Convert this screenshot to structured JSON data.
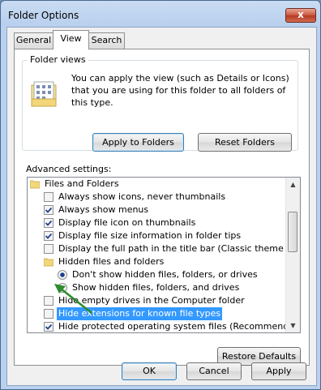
{
  "window": {
    "title": "Folder Options",
    "close_glyph": "x"
  },
  "tabs": [
    {
      "label": "General",
      "active": false
    },
    {
      "label": "View",
      "active": true
    },
    {
      "label": "Search",
      "active": false
    }
  ],
  "folder_views": {
    "label": "Folder views",
    "description": "You can apply the view (such as Details or Icons) that you are using for this folder to all folders of this type.",
    "apply_button": "Apply to Folders",
    "reset_button": "Reset Folders"
  },
  "advanced": {
    "label": "Advanced settings:",
    "items": [
      {
        "type": "folder",
        "label": "Files and Folders"
      },
      {
        "type": "checkbox",
        "checked": false,
        "label": "Always show icons, never thumbnails"
      },
      {
        "type": "checkbox",
        "checked": true,
        "label": "Always show menus"
      },
      {
        "type": "checkbox",
        "checked": true,
        "label": "Display file icon on thumbnails"
      },
      {
        "type": "checkbox",
        "checked": true,
        "label": "Display file size information in folder tips"
      },
      {
        "type": "checkbox",
        "checked": false,
        "label": "Display the full path in the title bar (Classic theme only)"
      },
      {
        "type": "folder",
        "label": "Hidden files and folders"
      },
      {
        "type": "radio",
        "checked": true,
        "label": "Don't show hidden files, folders, or drives"
      },
      {
        "type": "radio",
        "checked": false,
        "label": "Show hidden files, folders, and drives"
      },
      {
        "type": "checkbox",
        "checked": false,
        "label": "Hide empty drives in the Computer folder"
      },
      {
        "type": "checkbox",
        "checked": false,
        "selected": true,
        "label": "Hide extensions for known file types"
      },
      {
        "type": "checkbox",
        "checked": true,
        "label": "Hide protected operating system files (Recommended)"
      }
    ],
    "restore_button": "Restore Defaults"
  },
  "footer": {
    "ok": "OK",
    "cancel": "Cancel",
    "apply": "Apply"
  },
  "colors": {
    "selection": "#3399ff",
    "arrow": "#2e8b2e",
    "check": "#1b3f8f"
  },
  "icons": {
    "folder": "folder-icon",
    "folder_views": "folder-views-icon",
    "annotation": "green-arrow-icon"
  }
}
